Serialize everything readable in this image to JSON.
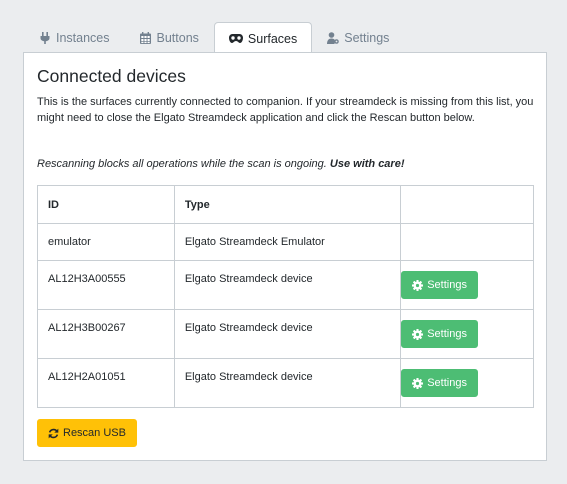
{
  "tabs": [
    {
      "label": "Instances",
      "icon": "plug-icon",
      "active": false
    },
    {
      "label": "Buttons",
      "icon": "calendar-grid-icon",
      "active": false
    },
    {
      "label": "Surfaces",
      "icon": "gamepad-icon",
      "active": true
    },
    {
      "label": "Settings",
      "icon": "user-cog-icon",
      "active": false
    }
  ],
  "surfaces": {
    "title": "Connected devices",
    "description": "This is the surfaces currently connected to companion. If your streamdeck is missing from this list, you might need to close the Elgato Streamdeck application and click the Rescan button below.",
    "warning_text": "Rescanning blocks all operations while the scan is ongoing.",
    "warning_emphasis": "Use with care!",
    "table": {
      "headers": [
        "ID",
        "Type",
        ""
      ],
      "rows": [
        {
          "id": "emulator",
          "type": "Elgato Streamdeck Emulator",
          "action": ""
        },
        {
          "id": "AL12H3A00555",
          "type": "Elgato Streamdeck device",
          "action": "Settings"
        },
        {
          "id": "AL12H3B00267",
          "type": "Elgato Streamdeck device",
          "action": "Settings"
        },
        {
          "id": "AL12H2A01051",
          "type": "Elgato Streamdeck device",
          "action": "Settings"
        }
      ]
    },
    "rescan_label": "Rescan USB"
  },
  "colors": {
    "success": "#4dbd74",
    "warning": "#ffc107",
    "background": "#ebedef",
    "border": "#c8ced3"
  }
}
